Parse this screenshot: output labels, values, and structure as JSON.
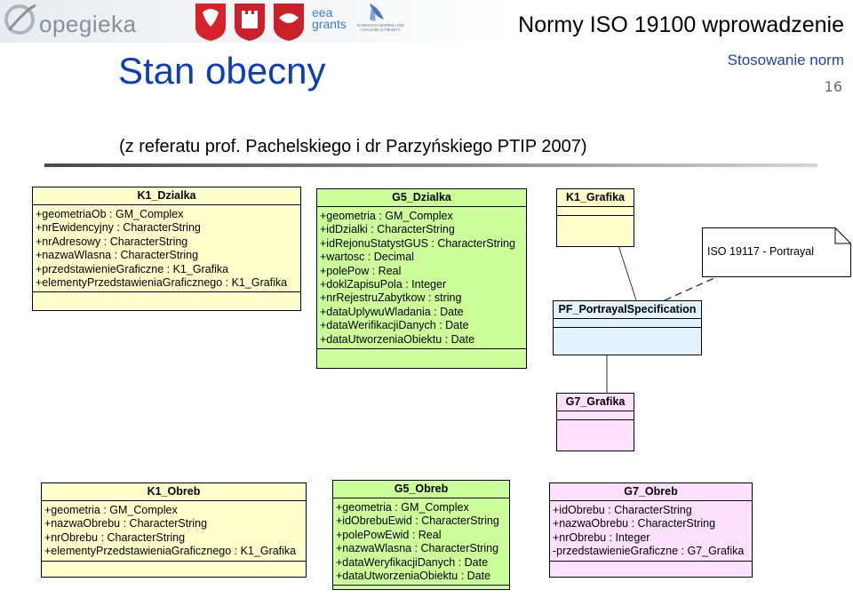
{
  "header": {
    "logo_text": "opegieka",
    "eea_text": "eea\ngrants",
    "norwegian_text": "NORWEGIAN MAPPING AND CADASTRE AUTHORITY",
    "title": "Normy ISO 19100 wprowadzenie"
  },
  "slide": {
    "title": "Stan obecny",
    "section": "Stosowanie norm",
    "page_number": "16",
    "subtitle": "(z referatu prof. Pachelskiego i dr Parzyńskiego PTIP 2007)"
  },
  "diagram": {
    "classes": {
      "k1_dzialka": {
        "name": "K1_Dzialka",
        "attributes": [
          "+geometriaOb : GM_Complex",
          "+nrEwidencyjny : CharacterString",
          "+nrAdresowy : CharacterString",
          "+nazwaWlasna : CharacterString",
          "+przedstawienieGraficzne : K1_Grafika",
          "+elementyPrzedstawieniaGraficznego : K1_Grafika"
        ]
      },
      "g5_dzialka": {
        "name": "G5_Dzialka",
        "attributes": [
          "+geometria : GM_Complex",
          "+idDzialki : CharacterString",
          "+idRejonuStatystGUS : CharacterString",
          "+wartosc : Decimal",
          "+polePow : Real",
          "+doklZapisuPola : Integer",
          "+nrRejestruZabytkow : string",
          "+dataUplywuWladania : Date",
          "+dataWerifikacjiDanych : Date",
          "+dataUtworzeniaObiektu : Date"
        ]
      },
      "k1_grafika": {
        "name": "K1_Grafika"
      },
      "pf_portrayal": {
        "name": "PF_PortrayalSpecification"
      },
      "g7_grafika": {
        "name": "G7_Grafika"
      },
      "k1_obreb": {
        "name": "K1_Obreb",
        "attributes": [
          "+geometria : GM_Complex",
          "+nazwaObrebu : CharacterString",
          "+nrObrebu : CharacterString",
          "+elementyPrzedstawieniaGraficznego : K1_Grafika"
        ]
      },
      "g5_obreb": {
        "name": "G5_Obreb",
        "attributes": [
          "+geometria : GM_Complex",
          "+idObrebuEwid : CharacterString",
          "+polePowEwid : Real",
          "+nazwaWlasna : CharacterString",
          "+dataWeryfikacjiDanych : Date",
          "+dataUtworzeniaObiektu : Date"
        ]
      },
      "g7_obreb": {
        "name": "G7_Obreb",
        "attributes": [
          "+idObrebu : CharacterString",
          "+nazwaObrebu : CharacterString",
          "+nrObrebu : Integer",
          "-przedstawienieGraficzne : G7_Grafika"
        ]
      }
    },
    "note": "ISO 19117 - Portrayal",
    "colors": {
      "yellow": "#ffffcc",
      "green": "#ccff99",
      "blue": "#e1f3ff",
      "pink": "#ffe0ff",
      "title_blue": "#0b3fb8"
    }
  }
}
